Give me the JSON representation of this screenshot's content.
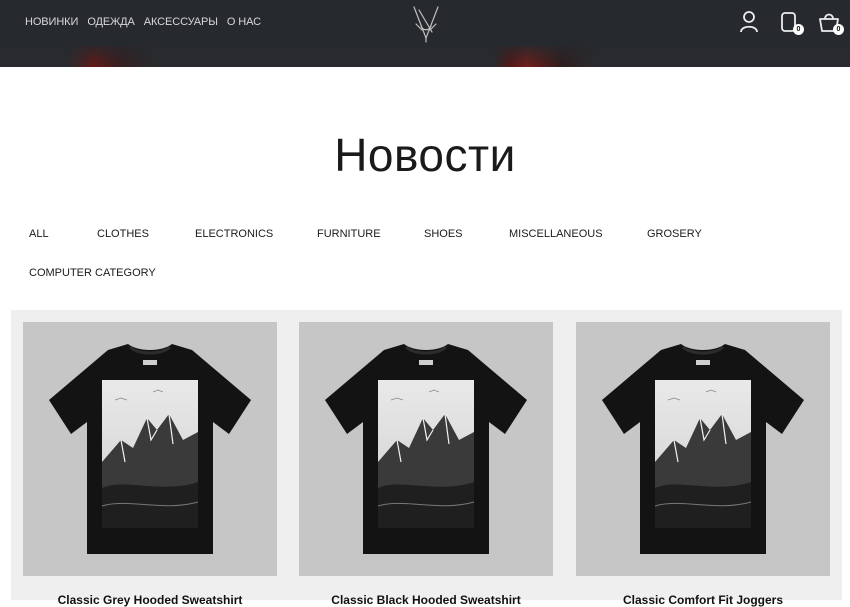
{
  "header": {
    "nav": [
      "НОВИНКИ",
      "ОДЕЖДА",
      "АКСЕССУАРЫ",
      "О НАС"
    ],
    "favorites_count": "0",
    "cart_count": "0"
  },
  "page": {
    "title": "Новости"
  },
  "categories": [
    "ALL",
    "CLOTHES",
    "ELECTRONICS",
    "FURNITURE",
    "SHOES",
    "MISCELLANEOUS",
    "GROSERY",
    "COMPUTER CATEGORY"
  ],
  "products": [
    {
      "name": "Classic Grey Hooded Sweatshirt"
    },
    {
      "name": "Classic Black Hooded Sweatshirt"
    },
    {
      "name": "Classic Comfort Fit Joggers"
    }
  ],
  "colors": {
    "header_bg": "#26292e",
    "accent_red": "#7a1d18",
    "products_bg": "#efefef"
  }
}
